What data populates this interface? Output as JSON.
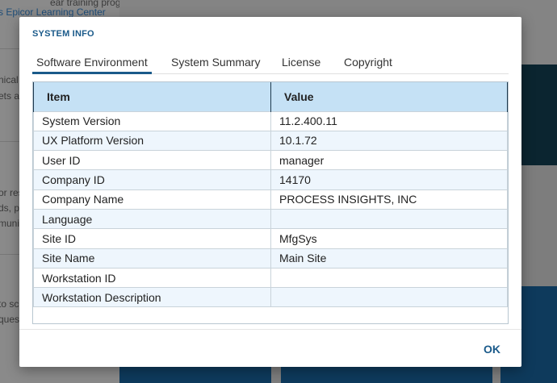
{
  "background": {
    "fragments": [
      {
        "text": "ear training program",
        "link": false
      },
      {
        "text": "s Epicor Learning Center",
        "link": true
      },
      {
        "text": "nical",
        "link": false
      },
      {
        "text": "ets a",
        "link": false
      },
      {
        "text": "or res",
        "link": false
      },
      {
        "text": "ds, p",
        "link": false
      },
      {
        "text": "munit",
        "link": false
      },
      {
        "text": "to sc",
        "link": false
      },
      {
        "text": "quest",
        "link": false
      }
    ]
  },
  "dialog": {
    "title": "SYSTEM INFO",
    "tabs": [
      {
        "label": "Software Environment",
        "active": true
      },
      {
        "label": "System Summary",
        "active": false
      },
      {
        "label": "License",
        "active": false
      },
      {
        "label": "Copyright",
        "active": false
      }
    ],
    "table": {
      "headers": [
        "Item",
        "Value"
      ],
      "rows": [
        {
          "item": "System Version",
          "value": "11.2.400.11"
        },
        {
          "item": "UX Platform Version",
          "value": "10.1.72"
        },
        {
          "item": "User ID",
          "value": "manager"
        },
        {
          "item": "Company ID",
          "value": "14170"
        },
        {
          "item": "Company Name",
          "value": "PROCESS INSIGHTS, INC"
        },
        {
          "item": "Language",
          "value": ""
        },
        {
          "item": "Site ID",
          "value": "MfgSys"
        },
        {
          "item": "Site Name",
          "value": "Main Site"
        },
        {
          "item": "Workstation ID",
          "value": ""
        },
        {
          "item": "Workstation Description",
          "value": ""
        }
      ]
    },
    "ok_label": "OK"
  },
  "colors": {
    "accent": "#1a5a8a",
    "header_bg": "#c5e1f5",
    "alt_row_bg": "#eef6fd"
  }
}
